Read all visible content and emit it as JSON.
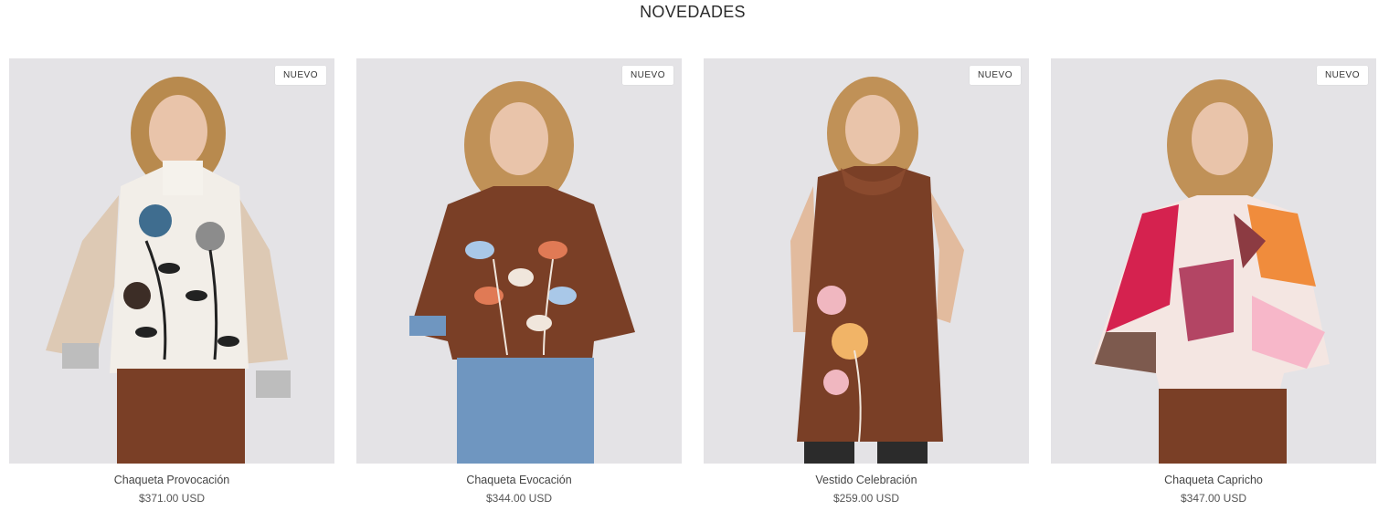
{
  "section": {
    "title": "NOVEDADES"
  },
  "products": [
    {
      "name": "Chaqueta Provocación",
      "price": "$371.00 USD",
      "badge": "NUEVO"
    },
    {
      "name": "Chaqueta Evocación",
      "price": "$344.00 USD",
      "badge": "NUEVO"
    },
    {
      "name": "Vestido Celebración",
      "price": "$259.00 USD",
      "badge": "NUEVO"
    },
    {
      "name": "Chaqueta Capricho",
      "price": "$347.00 USD",
      "badge": "NUEVO"
    }
  ],
  "colors": {
    "image_background": "#e4e3e6",
    "hair": "#b88a4e",
    "brown_fabric": "#7a3f26",
    "denim": "#6f96c0",
    "cream_fabric": "#f2eee8"
  }
}
